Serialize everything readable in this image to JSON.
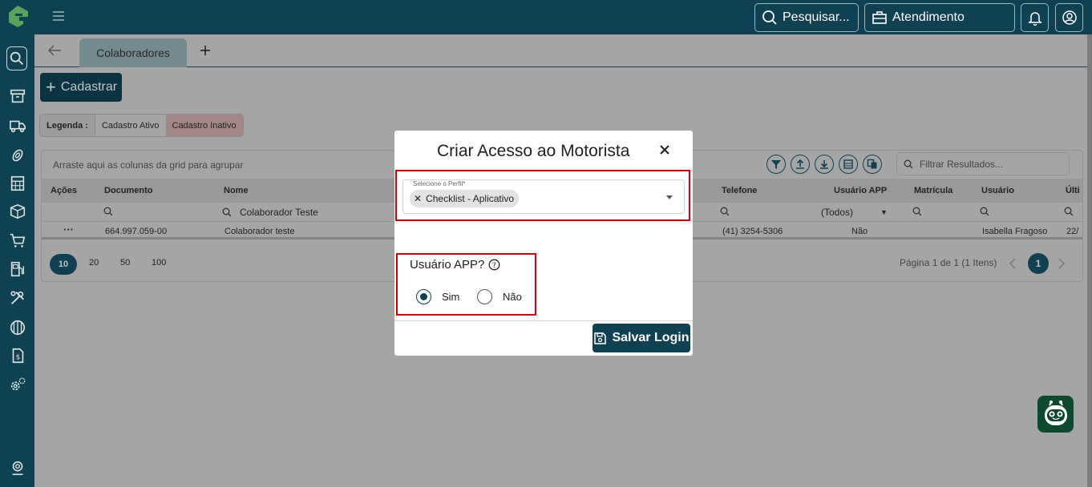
{
  "topbar": {
    "search_label": "Pesquisar...",
    "service_label": "Atendimento"
  },
  "tabs": {
    "active_tab": "Colaboradores",
    "add_label": "+"
  },
  "toolbar": {
    "cadastrar_label": "Cadastrar"
  },
  "legend": {
    "title": "Legenda :",
    "ativo": "Cadastro Ativo",
    "inativo": "Cadastro Inativo"
  },
  "grid": {
    "group_hint": "Arraste aqui as colunas da grid para agrupar",
    "filter_placeholder": "Filtrar Resultados...",
    "columns": [
      "Ações",
      "Documento",
      "Nome",
      "Telefone",
      "Usuário APP",
      "Matrícula",
      "Usuário",
      "Últi"
    ],
    "filters": {
      "nome": "Colaborador Teste",
      "usuario_app": "(Todos)"
    },
    "row": {
      "actions": "···",
      "documento": "664.997.059-00",
      "nome": "Colaborador teste",
      "telefone": "(41) 3254-5306",
      "usuario_app": "Não",
      "usuario": "Isabella Fragoso",
      "ultimo": "22/"
    },
    "page_sizes": [
      "10",
      "20",
      "50",
      "100"
    ],
    "page_info": "Página 1 de 1 (1 Itens)",
    "current_page": "1"
  },
  "modal": {
    "title": "Criar Acesso ao Motorista",
    "profile_label": "Selecione o Perfil*",
    "profile_chip": "Checklist - Aplicativo",
    "app_question": "Usuário APP?",
    "option_yes": "Sim",
    "option_no": "Não",
    "save_label": "Salvar Login"
  },
  "colors": {
    "primary": "#0f4152",
    "highlight": "#d60000",
    "inactive": "#a38786"
  }
}
